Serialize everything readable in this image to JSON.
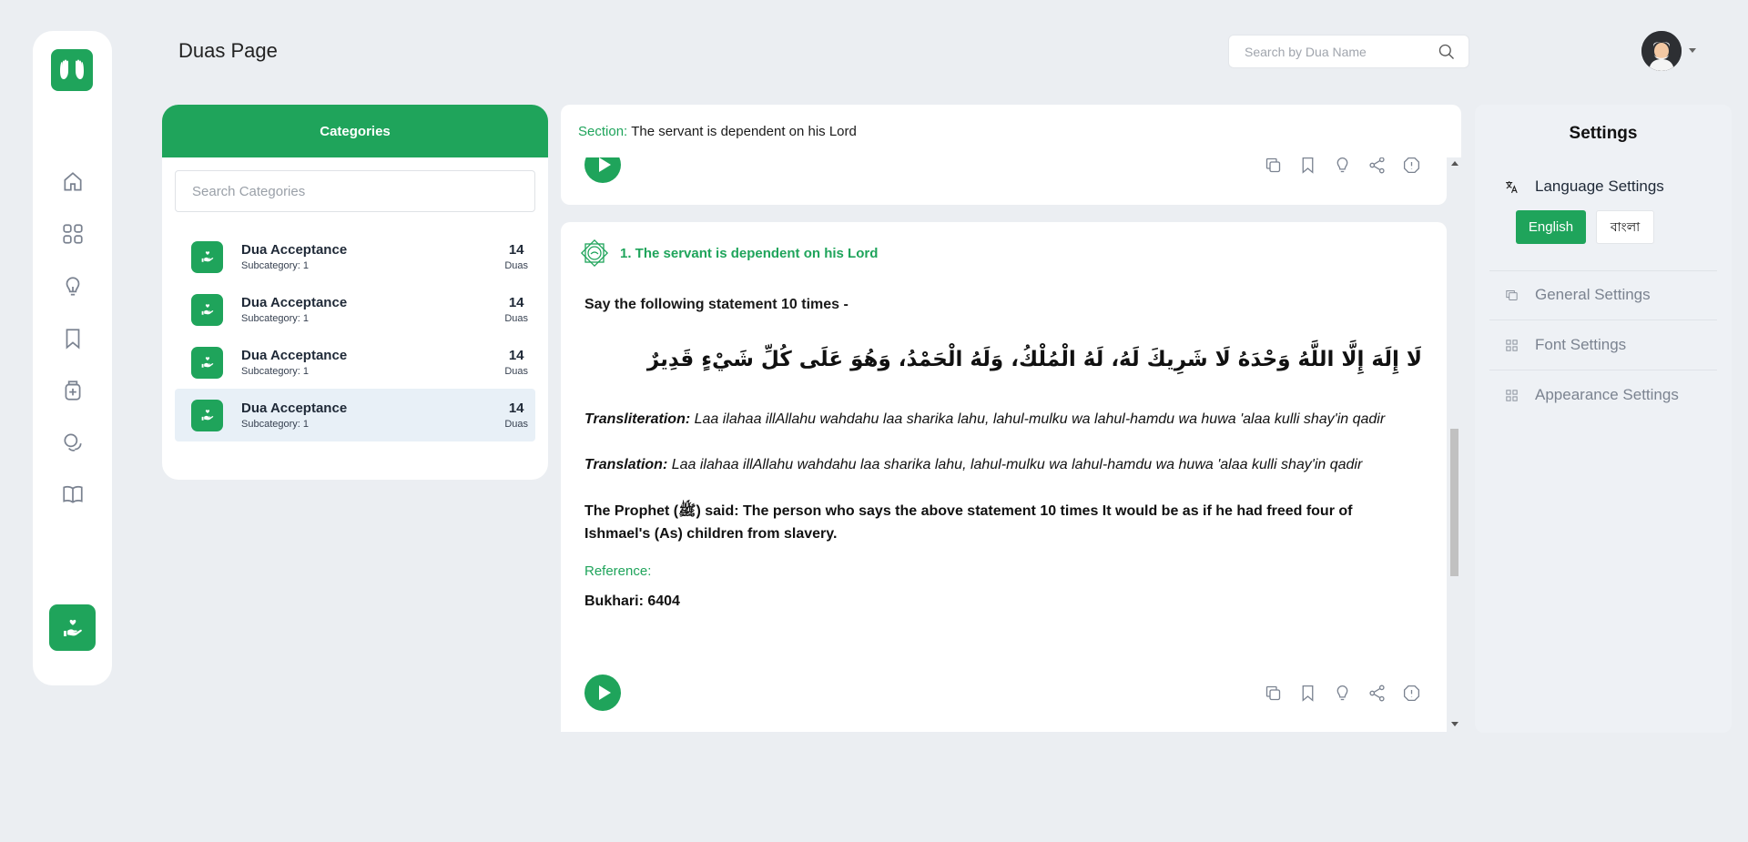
{
  "header": {
    "title": "Duas Page",
    "search_placeholder": "Search by Dua Name"
  },
  "sidebar": {
    "items": [
      {
        "icon": "home-icon"
      },
      {
        "icon": "grid-icon"
      },
      {
        "icon": "lightbulb-icon"
      },
      {
        "icon": "bookmark-icon"
      },
      {
        "icon": "medicine-icon"
      },
      {
        "icon": "chat-icon"
      },
      {
        "icon": "book-icon"
      }
    ]
  },
  "categories": {
    "title": "Categories",
    "search_placeholder": "Search Categories",
    "items": [
      {
        "name": "Dua Acceptance",
        "sub": "Subcategory: 1",
        "count": "14",
        "unit": "Duas"
      },
      {
        "name": "Dua Acceptance",
        "sub": "Subcategory: 1",
        "count": "14",
        "unit": "Duas"
      },
      {
        "name": "Dua Acceptance",
        "sub": "Subcategory: 1",
        "count": "14",
        "unit": "Duas"
      },
      {
        "name": "Dua Acceptance",
        "sub": "Subcategory: 1",
        "count": "14",
        "unit": "Duas"
      }
    ],
    "active_index": 3
  },
  "section": {
    "label": "Section:",
    "title": "The servant is dependent on his Lord"
  },
  "dua": {
    "title": "1. The servant is dependent on his Lord",
    "intro": "Say the following statement 10 times -",
    "arabic": "لَا إِلَهَ إِلَّا اللَّهُ وَحْدَهُ لَا شَرِيكَ لَهُ، لَهُ الْمُلْكُ، وَلَهُ الْحَمْدُ، وَهُوَ عَلَى كُلِّ شَيْءٍ قَدِيرٌ",
    "transliteration_label": "Transliteration:",
    "transliteration": "Laa ilahaa illAllahu wahdahu laa sharika lahu, lahul-mulku wa lahul-hamdu wa huwa 'alaa kulli shay'in qadir",
    "translation_label": "Translation:",
    "translation": "Laa ilahaa illAllahu wahdahu laa sharika lahu, lahul-mulku wa lahul-hamdu wa huwa 'alaa kulli shay'in qadir",
    "hadith": "The Prophet (ﷺ) said: The person who says the above statement 10 times It would be as if he had freed four of Ishmael's (As) children from slavery.",
    "reference_label": "Reference:",
    "reference": "Bukhari: 6404"
  },
  "settings": {
    "title": "Settings",
    "language_label": "Language Settings",
    "lang_en": "English",
    "lang_bn": "বাংলা",
    "general": "General Settings",
    "font": "Font Settings",
    "appearance": "Appearance Settings"
  },
  "colors": {
    "accent": "#1fa45b",
    "background": "#ebeef2"
  }
}
